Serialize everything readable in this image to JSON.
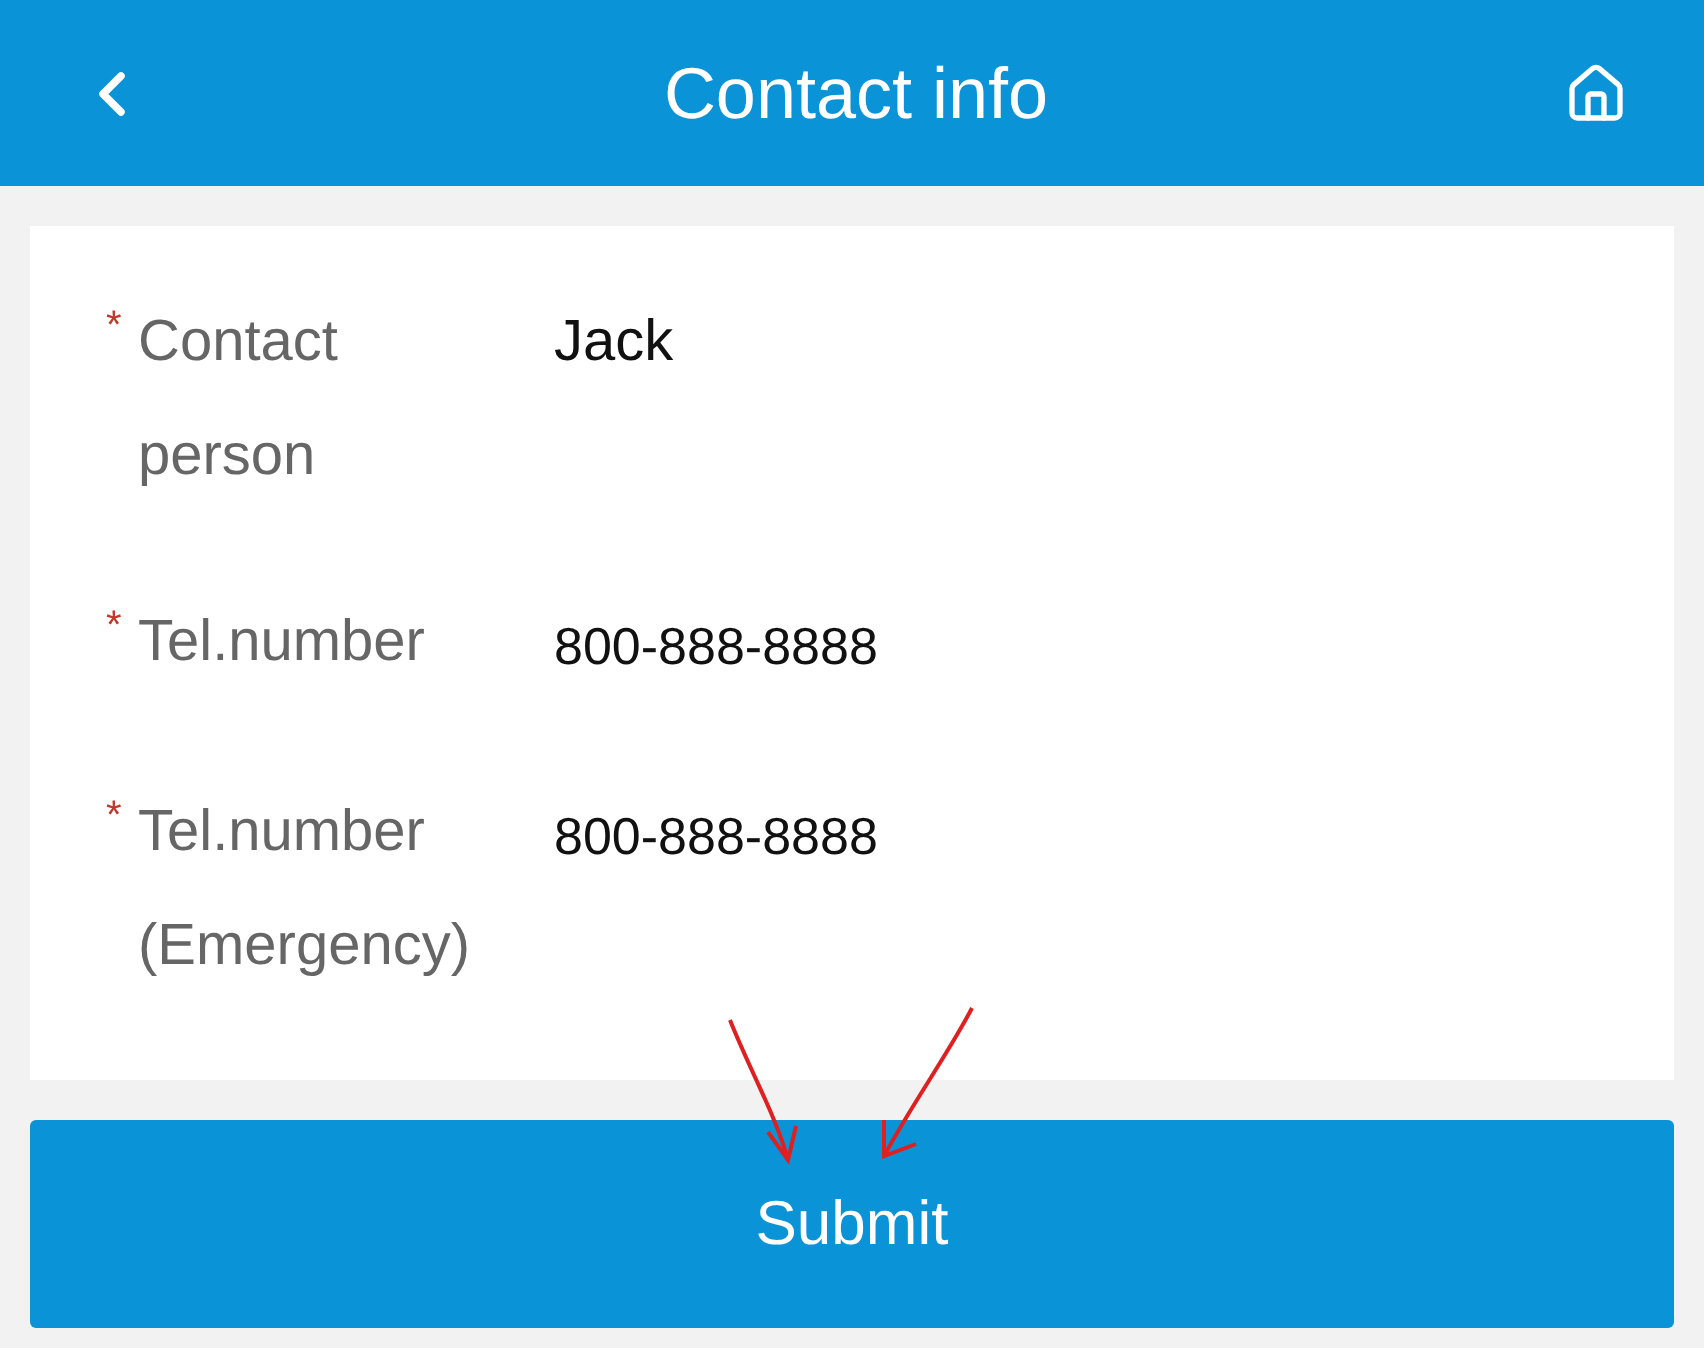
{
  "header": {
    "title": "Contact info"
  },
  "fields": [
    {
      "label": "Contact person",
      "required": true,
      "value": "Jack",
      "kind": "text"
    },
    {
      "label": "Tel.number",
      "required": true,
      "value": "800-888-8888",
      "kind": "phone"
    },
    {
      "label": "Tel.number (Emergency)",
      "required": true,
      "value": "800-888-8888",
      "kind": "phone"
    }
  ],
  "submit": {
    "label": "Submit"
  },
  "asterisk": "*"
}
